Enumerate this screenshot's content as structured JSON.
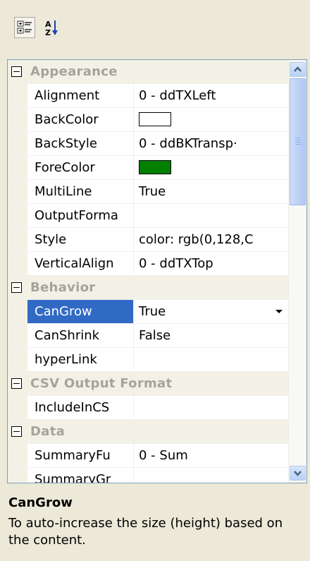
{
  "toolbar": {
    "categorized_icon": "categorized-icon",
    "alphabetical_icon": "alphabetical-icon"
  },
  "grid": {
    "categories": [
      {
        "name": "Appearance",
        "properties": [
          {
            "name": "Alignment",
            "value": "0 - ddTXLeft"
          },
          {
            "name": "BackColor",
            "value": "",
            "swatch": "#ffffff"
          },
          {
            "name": "BackStyle",
            "value": "0 - ddBKTransp·"
          },
          {
            "name": "ForeColor",
            "value": "",
            "swatch": "#007f00"
          },
          {
            "name": "MultiLine",
            "value": "True"
          },
          {
            "name": "OutputForma",
            "value": ""
          },
          {
            "name": "Style",
            "value": "color: rgb(0,128,C"
          },
          {
            "name": "VerticalAlign",
            "value": "0 - ddTXTop"
          }
        ]
      },
      {
        "name": "Behavior",
        "properties": [
          {
            "name": "CanGrow",
            "value": "True",
            "selected": true
          },
          {
            "name": "CanShrink",
            "value": "False"
          },
          {
            "name": "hyperLink",
            "value": ""
          }
        ]
      },
      {
        "name": "CSV Output Format",
        "properties": [
          {
            "name": "IncludeInCS",
            "value": ""
          }
        ]
      },
      {
        "name": "Data",
        "properties": [
          {
            "name": "SummaryFu",
            "value": "0 - Sum"
          },
          {
            "name": "SummaryGr",
            "value": ""
          }
        ]
      }
    ]
  },
  "help": {
    "title": "CanGrow",
    "description": "To auto-increase the size (height) based on the content."
  },
  "colors": {
    "selection": "#316ac5",
    "category_text": "#a7a39a",
    "panel": "#ece9d8"
  }
}
